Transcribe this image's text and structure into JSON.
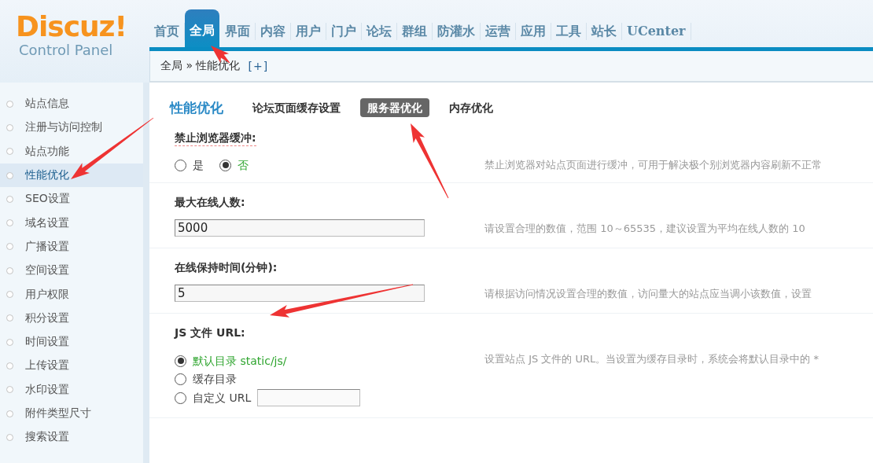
{
  "logo": {
    "title": "Discuz!",
    "subtitle": "Control Panel"
  },
  "nav": [
    {
      "label": "首页",
      "selected": false
    },
    {
      "label": "全局",
      "selected": true
    },
    {
      "label": "界面",
      "selected": false
    },
    {
      "label": "内容",
      "selected": false
    },
    {
      "label": "用户",
      "selected": false
    },
    {
      "label": "门户",
      "selected": false
    },
    {
      "label": "论坛",
      "selected": false
    },
    {
      "label": "群组",
      "selected": false
    },
    {
      "label": "防灌水",
      "selected": false
    },
    {
      "label": "运营",
      "selected": false
    },
    {
      "label": "应用",
      "selected": false
    },
    {
      "label": "工具",
      "selected": false
    },
    {
      "label": "站长",
      "selected": false
    },
    {
      "label": "UCenter",
      "selected": false
    }
  ],
  "breadcrumb": {
    "path": "全局 » 性能优化",
    "toggle": "[+]"
  },
  "sidebar": {
    "items": [
      {
        "label": "站点信息",
        "selected": false
      },
      {
        "label": "注册与访问控制",
        "selected": false
      },
      {
        "label": "站点功能",
        "selected": false
      },
      {
        "label": "性能优化",
        "selected": true
      },
      {
        "label": "SEO设置",
        "selected": false
      },
      {
        "label": "域名设置",
        "selected": false
      },
      {
        "label": "广播设置",
        "selected": false
      },
      {
        "label": "空间设置",
        "selected": false
      },
      {
        "label": "用户权限",
        "selected": false
      },
      {
        "label": "积分设置",
        "selected": false
      },
      {
        "label": "时间设置",
        "selected": false
      },
      {
        "label": "上传设置",
        "selected": false
      },
      {
        "label": "水印设置",
        "selected": false
      },
      {
        "label": "附件类型尺寸",
        "selected": false
      },
      {
        "label": "搜索设置",
        "selected": false
      }
    ]
  },
  "page": {
    "title": "性能优化",
    "tabs": [
      {
        "label": "论坛页面缓存设置",
        "selected": false
      },
      {
        "label": "服务器优化",
        "selected": true
      },
      {
        "label": "内存优化",
        "selected": false
      }
    ]
  },
  "settings": [
    {
      "kind": "radio-row",
      "label": "禁止浏览器缓冲:",
      "tooltip": true,
      "options": [
        {
          "label": "是",
          "selected": false
        },
        {
          "label": "否",
          "selected": true
        }
      ],
      "description": "禁止浏览器对站点页面进行缓冲，可用于解决极个别浏览器内容刷新不正常"
    },
    {
      "kind": "text",
      "label": "最大在线人数:",
      "tooltip": false,
      "value": "5000",
      "description": "请设置合理的数值，范围 10～65535，建议设置为平均在线人数的 10"
    },
    {
      "kind": "text",
      "label": "在线保持时间(分钟):",
      "tooltip": false,
      "value": "5",
      "description": "请根据访问情况设置合理的数值，访问量大的站点应当调小该数值，设置"
    },
    {
      "kind": "radio-list",
      "label": "JS 文件 URL:",
      "tooltip": false,
      "options": [
        {
          "label": "默认目录 static/js/",
          "selected": true
        },
        {
          "label": "缓存目录",
          "selected": false
        },
        {
          "label": "自定义 URL",
          "selected": false,
          "field": true
        }
      ],
      "description": "设置站点 JS 文件的 URL。当设置为缓存目录时，系统会将默认目录中的 *"
    }
  ]
}
